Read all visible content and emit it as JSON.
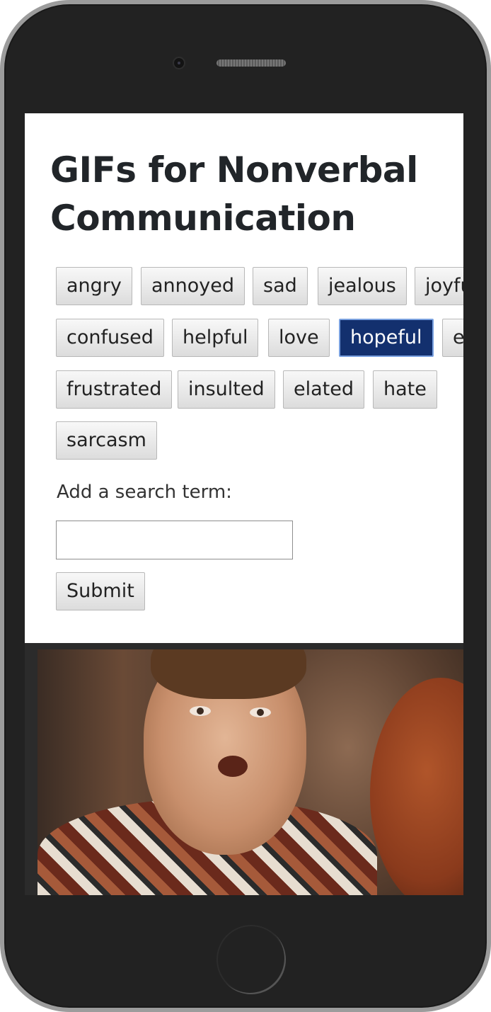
{
  "page": {
    "title": "GIFs for Nonverbal Communication"
  },
  "tags": [
    {
      "label": "angry",
      "active": false
    },
    {
      "label": "annoyed",
      "active": false
    },
    {
      "label": "sad",
      "active": false
    },
    {
      "label": "jealous",
      "active": false
    },
    {
      "label": "joyful",
      "active": false
    },
    {
      "label": "confused",
      "active": false
    },
    {
      "label": "helpful",
      "active": false
    },
    {
      "label": "love",
      "active": false
    },
    {
      "label": "hopeful",
      "active": true
    },
    {
      "label": "e",
      "active": false
    },
    {
      "label": "frustrated",
      "active": false
    },
    {
      "label": "insulted",
      "active": false
    },
    {
      "label": "elated",
      "active": false
    },
    {
      "label": "hate",
      "active": false
    },
    {
      "label": "sarcasm",
      "active": false
    }
  ],
  "search": {
    "label": "Add a search term:",
    "value": "",
    "placeholder": "",
    "submit_label": "Submit"
  },
  "colors": {
    "active_tag_bg": "#13306e",
    "active_tag_border": "#7aa1e0",
    "phone_body": "#222222"
  }
}
